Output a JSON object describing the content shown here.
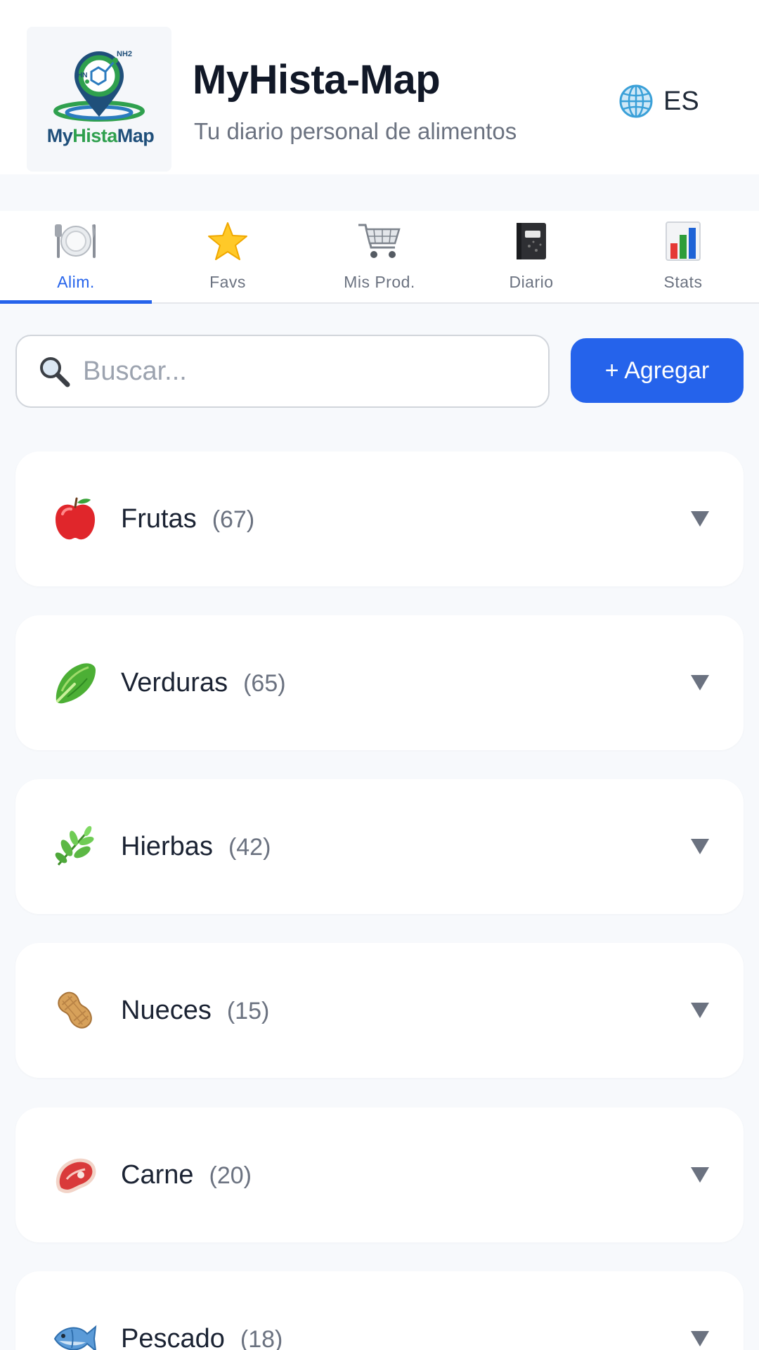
{
  "header": {
    "logo": {
      "my": "My",
      "hista": "Hista",
      "map": "Map",
      "chem_label": "NH2",
      "hn_label": "HN"
    },
    "title": "MyHista-Map",
    "subtitle": "Tu diario personal de alimentos",
    "language": {
      "icon": "globe-icon",
      "label": "ES"
    }
  },
  "tabs": [
    {
      "label": "Alim.",
      "icon": "plate-icon",
      "active": true
    },
    {
      "label": "Favs",
      "icon": "star-icon",
      "active": false
    },
    {
      "label": "Mis Prod.",
      "icon": "cart-icon",
      "active": false
    },
    {
      "label": "Diario",
      "icon": "notebook-icon",
      "active": false
    },
    {
      "label": "Stats",
      "icon": "bar-chart-icon",
      "active": false
    }
  ],
  "search": {
    "placeholder": "Buscar...",
    "value": "",
    "icon": "magnifier-icon"
  },
  "add_button": {
    "label": "+ Agregar"
  },
  "categories": [
    {
      "name": "Frutas",
      "count": "(67)",
      "icon": "apple-icon"
    },
    {
      "name": "Verduras",
      "count": "(65)",
      "icon": "lettuce-icon"
    },
    {
      "name": "Hierbas",
      "count": "(42)",
      "icon": "herb-icon"
    },
    {
      "name": "Nueces",
      "count": "(15)",
      "icon": "peanut-icon"
    },
    {
      "name": "Carne",
      "count": "(20)",
      "icon": "meat-icon"
    },
    {
      "name": "Pescado",
      "count": "(18)",
      "icon": "fish-icon"
    }
  ],
  "colors": {
    "accent": "#2563eb",
    "background": "#f7f9fc",
    "card": "#ffffff",
    "muted": "#6b7280"
  }
}
